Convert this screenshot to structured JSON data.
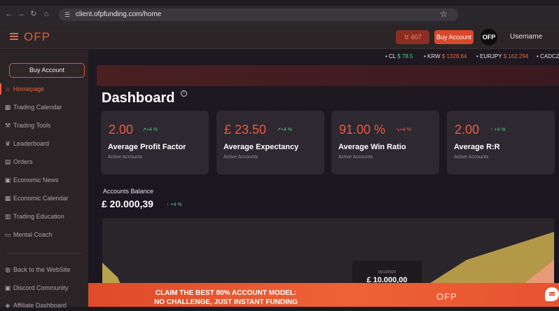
{
  "browser": {
    "url": "client.ofpfunding.com/home",
    "back_icon": "arrow-left-icon",
    "forward_icon": "arrow-right-icon",
    "reload_icon": "reload-icon",
    "home_icon": "home-icon",
    "bookmark_icon": "star-icon"
  },
  "topbar": {
    "brand": "OFP",
    "points": "607",
    "buy_label": "Buy Account",
    "avatar_text": "OFP",
    "username": "Username"
  },
  "sidebar": {
    "buy_label": "Buy Account",
    "items": [
      {
        "label": "Homepage",
        "glyph": "⌂"
      },
      {
        "label": "Trading Calendar",
        "glyph": "▦"
      },
      {
        "label": "Trading Tools",
        "glyph": "⚒"
      },
      {
        "label": "Leaderboard",
        "glyph": "♛"
      },
      {
        "label": "Orders",
        "glyph": "▤"
      },
      {
        "label": "Economic News",
        "glyph": "▣"
      },
      {
        "label": "Economic Calendar",
        "glyph": "▦"
      },
      {
        "label": "Trading Education",
        "glyph": "▥"
      },
      {
        "label": "Mental Coach",
        "glyph": "▭"
      },
      {
        "label": "Back to the WebSite",
        "glyph": "◍"
      },
      {
        "label": "Discord Community",
        "glyph": "▣"
      },
      {
        "label": "Affiliate Dashboard",
        "glyph": "◈"
      }
    ]
  },
  "ticker": [
    {
      "symbol": "CL",
      "value": "$ 78.5",
      "dir": "pos"
    },
    {
      "symbol": "KRW",
      "value": "$ 1328.64",
      "dir": "neg"
    },
    {
      "symbol": "EURJPY",
      "value": "$ 162.294",
      "dir": "neg"
    },
    {
      "symbol": "CADCZK",
      "value": "",
      "dir": "pos"
    }
  ],
  "dashboard": {
    "title": "Dashboard",
    "cards": [
      {
        "value": "2.00",
        "change": "+4 %",
        "title": "Average Profit Factor",
        "subtitle": "Active Accounts",
        "dir": "pos"
      },
      {
        "value": "£ 23.50",
        "change": "+4 %",
        "title": "Average Expectancy",
        "subtitle": "Active Accounts",
        "dir": "pos"
      },
      {
        "value": "91.00 %",
        "change": "+4 %",
        "title": "Average Win Ratio",
        "subtitle": "Active Accounts",
        "dir": "neg"
      },
      {
        "value": "2.00",
        "change": "+4 %",
        "title": "Average R:R",
        "subtitle": "Active Accounts",
        "dir": "pos"
      }
    ],
    "balance": {
      "label": "Accounts Balance",
      "value": "£ 20.000,39",
      "change": "+4 %"
    },
    "tooltip": {
      "date": "05/10/2023",
      "value": "£ 10.000,00"
    }
  },
  "promo": {
    "line1": "CLAIM THE BEST 80% ACCOUNT MODEL:",
    "line2": "NO CHALLENGE, JUST INSTANT FUNDING",
    "logo": "OFP"
  },
  "colors": {
    "accent": "#e25335",
    "positive": "#4fd08a",
    "negative": "#e8654a",
    "card_bg": "#2e2830",
    "sidebar_bg": "#2a2427"
  }
}
